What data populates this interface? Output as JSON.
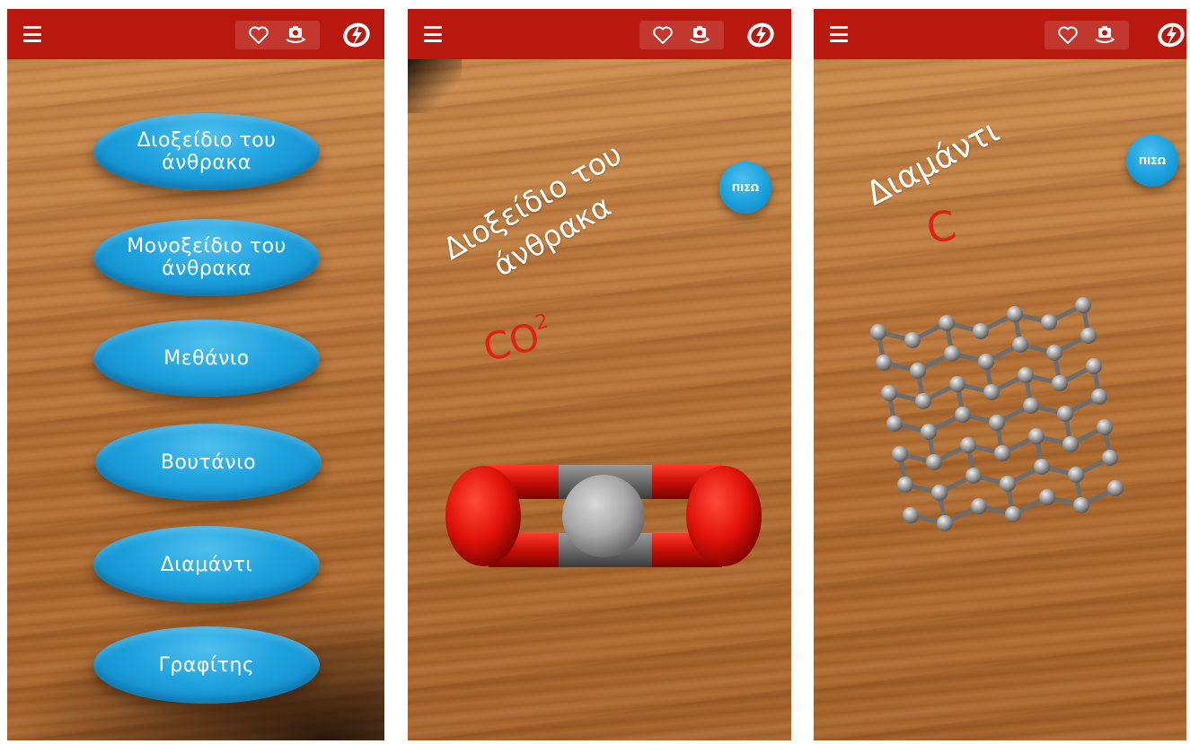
{
  "screens": [
    {
      "id": "menu",
      "menu_items": [
        {
          "label": "Διοξείδιο του\nάνθρακα"
        },
        {
          "label": "Μονοξείδιο του\nάνθρακα"
        },
        {
          "label": "Μεθάνιο"
        },
        {
          "label": "Βουτάνιο"
        },
        {
          "label": "Διαμάντι"
        },
        {
          "label": "Γραφίτης"
        }
      ]
    },
    {
      "id": "co2",
      "back_label": "ΠΙΣΩ",
      "title": "Διοξείδιο του\nάνθρακα",
      "formula_base": "CO",
      "formula_sub": "2"
    },
    {
      "id": "diamond",
      "back_label": "ΠΙΣΩ",
      "title": "Διαμάντι",
      "formula": "C"
    }
  ],
  "icons": {
    "menu": "hamburger-menu-icon",
    "favorite": "heart-icon",
    "camera": "camera-switch-icon",
    "brand": "brand-logo-icon"
  },
  "colors": {
    "topbar": "#b8180d",
    "button": "#1ea2dd",
    "formula": "#e02014"
  }
}
